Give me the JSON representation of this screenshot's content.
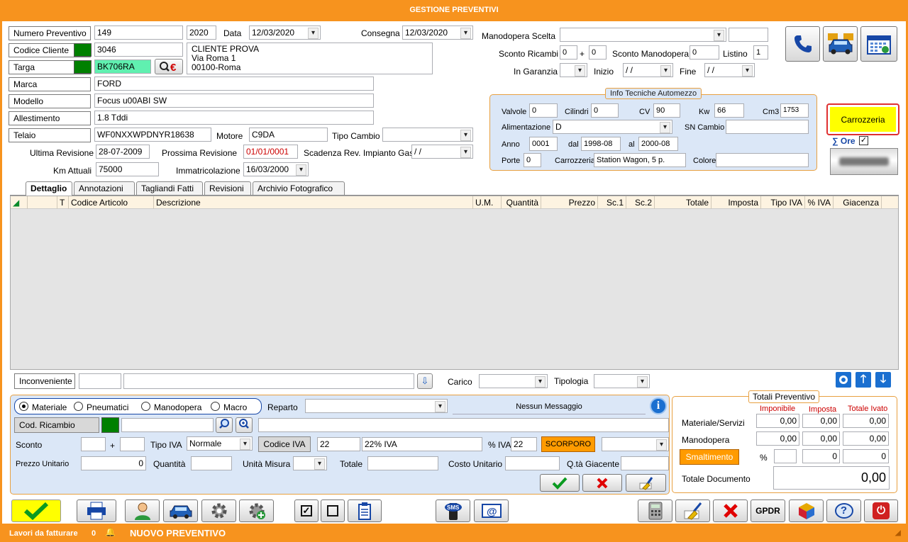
{
  "window": {
    "title": "GESTIONE PREVENTIVI"
  },
  "header": {
    "numero_preventivo": {
      "label": "Numero Preventivo",
      "value": "149",
      "year": "2020"
    },
    "data": {
      "label": "Data",
      "value": "12/03/2020"
    },
    "consegna": {
      "label": "Consegna",
      "value": "12/03/2020"
    },
    "codice_cliente": {
      "label": "Codice Cliente",
      "value": "3046"
    },
    "cliente": {
      "name": "CLIENTE PROVA",
      "address": "Via Roma 1",
      "city": "00100-Roma"
    },
    "targa": {
      "label": "Targa",
      "value": "BK706RA"
    },
    "marca": {
      "label": "Marca",
      "value": "FORD"
    },
    "modello": {
      "label": "Modello",
      "value": "Focus u00ABI SW"
    },
    "allestimento": {
      "label": "Allestimento",
      "value": "1.8 Tddi"
    },
    "telaio": {
      "label": "Telaio",
      "value": "WF0NXXWPDNYR18638"
    },
    "motore": {
      "label": "Motore",
      "value": "C9DA"
    },
    "tipo_cambio": {
      "label": "Tipo Cambio",
      "value": ""
    },
    "ultima_revisione": {
      "label": "Ultima Revisione",
      "value": "28-07-2009"
    },
    "prossima_revisione": {
      "label": "Prossima Revisione",
      "value": "01/01/0001"
    },
    "scadenza_gas": {
      "label": "Scadenza Rev. Impianto Gas",
      "value": "/  /"
    },
    "km_attuali": {
      "label": "Km Attuali",
      "value": "75000"
    },
    "immatricolazione": {
      "label": "Immatricolazione",
      "value": "16/03/2000"
    },
    "manodopera_scelta": {
      "label": "Manodopera Scelta",
      "value": ""
    },
    "sconto_ricambi": {
      "label": "Sconto Ricambi",
      "v1": "0",
      "plus": "+",
      "v2": "0"
    },
    "sconto_manodopera": {
      "label": "Sconto Manodopera",
      "value": "0"
    },
    "listino": {
      "label": "Listino",
      "value": "1"
    },
    "in_garanzia": {
      "label": "In Garanzia",
      "value": ""
    },
    "inizio": {
      "label": "Inizio",
      "value": "/  /"
    },
    "fine": {
      "label": "Fine",
      "value": "/  /"
    }
  },
  "info_tecniche": {
    "title": "Info Tecniche Automezzo",
    "valvole": {
      "label": "Valvole",
      "value": "0"
    },
    "cilindri": {
      "label": "Cilindri",
      "value": "0"
    },
    "cv": {
      "label": "CV",
      "value": "90"
    },
    "kw": {
      "label": "Kw",
      "value": "66"
    },
    "cm3": {
      "label": "Cm3",
      "value": "1753"
    },
    "alimentazione": {
      "label": "Alimentazione",
      "value": "D"
    },
    "sn_cambio": {
      "label": "SN Cambio",
      "value": ""
    },
    "anno": {
      "label": "Anno",
      "value": "0001"
    },
    "dal": {
      "label": "dal",
      "value": "1998-08"
    },
    "al": {
      "label": "al",
      "value": "2000-08"
    },
    "porte": {
      "label": "Porte",
      "value": "0"
    },
    "carrozzeria": {
      "label": "Carrozzeria",
      "value": "Station Wagon, 5 p."
    },
    "colore": {
      "label": "Colore",
      "value": ""
    }
  },
  "side": {
    "carrozzeria_btn": "Carrozzeria",
    "ore_label": "∑ Ore"
  },
  "tabs": [
    "Dettaglio",
    "Annotazioni",
    "Tagliandi Fatti",
    "Revisioni",
    "Archivio Fotografico"
  ],
  "grid": {
    "columns": [
      "T",
      "Codice Articolo",
      "Descrizione",
      "U.M.",
      "Quantità",
      "Prezzo",
      "Sc.1",
      "Sc.2",
      "Totale",
      "Imposta",
      "Tipo IVA",
      "% IVA",
      "Giacenza"
    ]
  },
  "bottom": {
    "inconveniente": "Inconveniente",
    "carico": "Carico",
    "tipologia": "Tipologia",
    "radio": [
      "Materiale",
      "Pneumatici",
      "Manodopera",
      "Macro"
    ],
    "reparto": "Reparto",
    "messaggio": "Nessun Messaggio",
    "cod_ricambio": "Cod. Ricambio",
    "sconto": "Sconto",
    "plus": "+",
    "tipo_iva": {
      "label": "Tipo IVA",
      "value": "Normale"
    },
    "codice_iva": {
      "label": "Codice IVA",
      "value": "22",
      "desc": "22% IVA"
    },
    "perc_iva": {
      "label": "% IVA",
      "value": "22"
    },
    "scorporo": "SCORPORO",
    "prezzo_unitario": {
      "label": "Prezzo Unitario",
      "value": "0"
    },
    "quantita": "Quantità",
    "unita_misura": "Unità Misura",
    "totale": "Totale",
    "costo_unitario": "Costo Unitario",
    "qta_giacente": "Q.tà Giacente"
  },
  "totali": {
    "title": "Totali Preventivo",
    "col_imponibile": "Imponibile",
    "col_imposta": "Imposta",
    "col_totale": "Totale Ivato",
    "materiale": {
      "label": "Materiale/Servizi",
      "imponibile": "0,00",
      "imposta": "0,00",
      "totale": "0,00"
    },
    "manodopera": {
      "label": "Manodopera",
      "imponibile": "0,00",
      "imposta": "0,00",
      "totale": "0,00"
    },
    "smaltimento": {
      "label": "Smaltimento",
      "perc": "%",
      "imposta": "0",
      "totale": "0"
    },
    "documento": {
      "label": "Totale Documento",
      "value": "0,00"
    }
  },
  "toolbar": {
    "gpdr": "GPDR"
  },
  "status": {
    "lavori": "Lavori da fatturare",
    "count": "0",
    "message": "NUOVO  PREVENTIVO"
  },
  "colors": {
    "accent": "#f7931e",
    "panel": "#dbe7f7",
    "green": "#008000",
    "highlight": "#ffff00"
  }
}
